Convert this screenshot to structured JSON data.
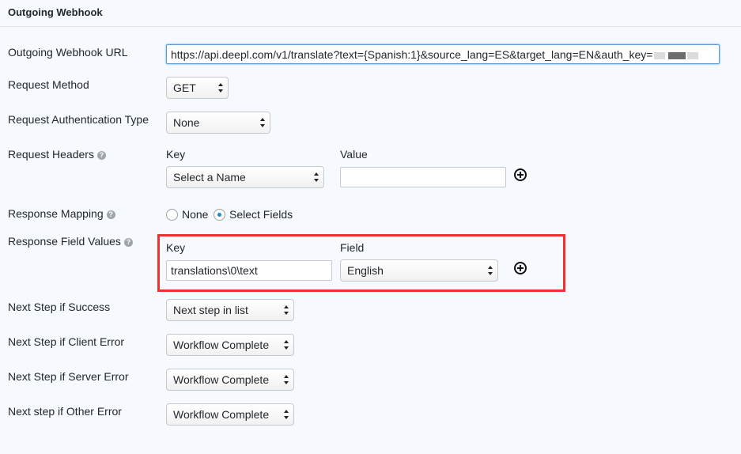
{
  "section": {
    "title": "Outgoing Webhook"
  },
  "url": {
    "label": "Outgoing Webhook URL",
    "value": "https://api.deepl.com/v1/translate?text={Spanish:1}&source_lang=ES&target_lang=EN&auth_key="
  },
  "method": {
    "label": "Request Method",
    "value": "GET"
  },
  "auth": {
    "label": "Request Authentication Type",
    "value": "None"
  },
  "headers": {
    "label": "Request Headers",
    "key_header": "Key",
    "value_header": "Value",
    "key_select": "Select a Name",
    "value_input": ""
  },
  "mapping": {
    "label": "Response Mapping",
    "options": [
      "None",
      "Select Fields"
    ],
    "selected": "Select Fields"
  },
  "field_values": {
    "label": "Response Field Values",
    "key_header": "Key",
    "field_header": "Field",
    "key_value": "translations\\0\\text",
    "field_value": "English"
  },
  "next_steps": [
    {
      "label": "Next Step if Success",
      "value": "Next step in list"
    },
    {
      "label": "Next Step if Client Error",
      "value": "Workflow Complete"
    },
    {
      "label": "Next Step if Server Error",
      "value": "Workflow Complete"
    },
    {
      "label": "Next step if Other Error",
      "value": "Workflow Complete"
    }
  ],
  "icons": {
    "help": "question-circle-icon",
    "add": "plus-circle-icon",
    "select_arrows": "up-down-arrows-icon"
  },
  "colors": {
    "highlight": "#f1312b",
    "focus_border": "#5b9dd9",
    "radio_accent": "#1e8cbe"
  }
}
